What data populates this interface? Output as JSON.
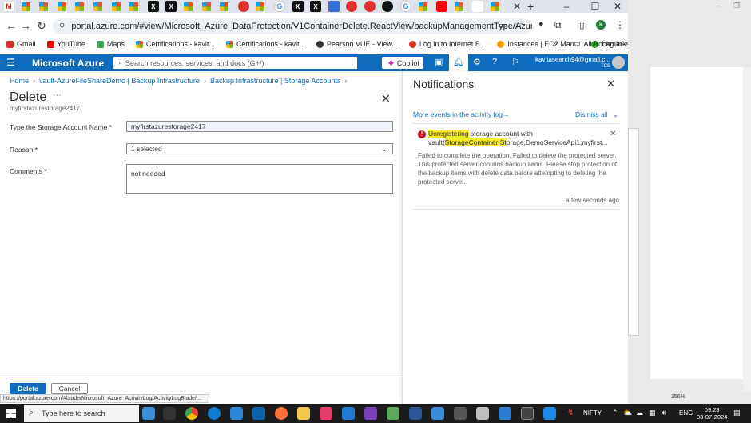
{
  "browser": {
    "url": "portal.azure.com/#view/Microsoft_Azure_DataProtection/V1ContainerDelete.ReactView/backupManagementType/AzureStorage/containerId/%2...",
    "profile_initial": "k",
    "bookmarks": [
      {
        "label": "Gmail",
        "color": "#d93025"
      },
      {
        "label": "YouTube",
        "color": "#ff0000"
      },
      {
        "label": "Maps",
        "color": "#34a853"
      },
      {
        "label": "Certifications - kavit...",
        "color": "#f25022"
      },
      {
        "label": "Certifications - kavit...",
        "color": "#f25022"
      },
      {
        "label": "Pearson VUE - View...",
        "color": "#333333"
      },
      {
        "label": "Log in to Internet B...",
        "color": "#d93025"
      },
      {
        "label": "Instances | EC2 Man...",
        "color": "#ff9900"
      },
      {
        "label": "Log In - Upwork",
        "color": "#14a800"
      }
    ],
    "bookmarks_more": "»",
    "all_bookmarks": "All Bookmarks",
    "status_url": "https://portal.azure.com/#blade/Microsoft_Azure_ActivityLog/ActivityLogBlade/..."
  },
  "azure": {
    "brand": "Microsoft Azure",
    "search_placeholder": "Search resources, services, and docs (G+/)",
    "copilot": "Copilot",
    "user_email": "kavitasearch94@gmail.c...",
    "user_org": "TCS"
  },
  "blade": {
    "breadcrumb": [
      "Home",
      "vault-AzureFileShareDemo | Backup Infrastructure",
      "Backup Infrastructure | Storage Accounts"
    ],
    "title": "Delete",
    "more": "···",
    "subtitle": "myfirstazurestorage2417",
    "fields": {
      "account_label": "Type the Storage Account Name *",
      "account_value": "myfirstazurestorage2417",
      "reason_label": "Reason *",
      "reason_value": "1 selected",
      "comments_label": "Comments *",
      "comments_value": "not needed"
    },
    "delete_label": "Delete",
    "cancel_label": "Cancel"
  },
  "notifications": {
    "title": "Notifications",
    "more_events": "More events in the activity log→",
    "dismiss_all": "Dismiss all",
    "card": {
      "title_pre": "Unregistering",
      "title_mid": " storage account with vault(",
      "title_hl": "StorageContainer;St",
      "title_post": "orage;DemoServiceApi1;myfirst...",
      "body": "Failed to complete the operation. Failed to delete the protected server. This protected server contains backup items. Please stop protection of the backup items with delete data before attempting to deleting the protected server.",
      "time": "a few seconds ago"
    }
  },
  "right_window": {
    "zoom": "156%"
  },
  "taskbar": {
    "search_placeholder": "Type here to search",
    "nifty": "NIFTY",
    "lang": "ENG",
    "time": "09:23",
    "date": "03-07-2024"
  }
}
